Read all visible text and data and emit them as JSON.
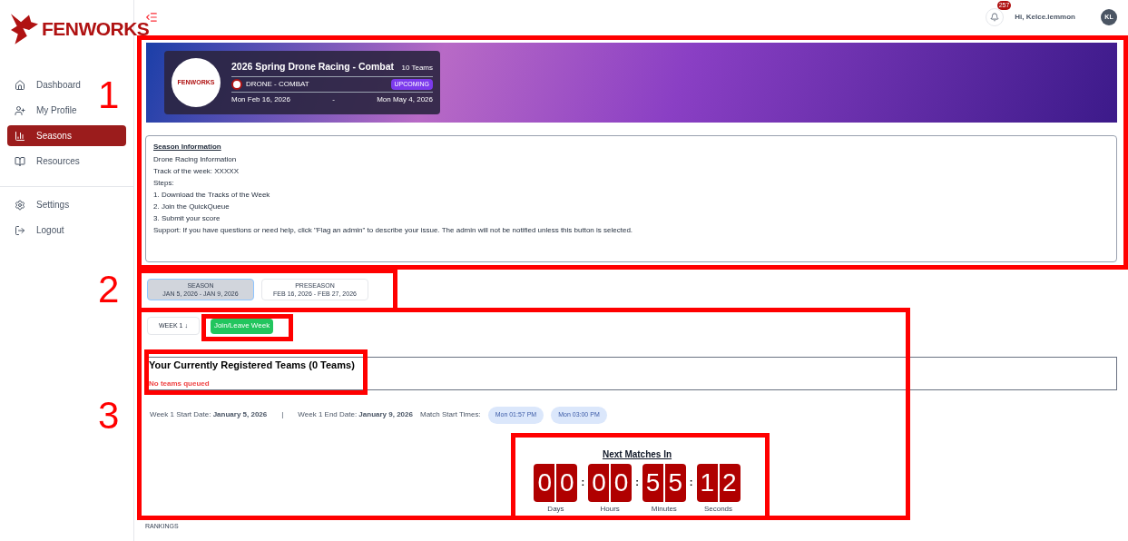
{
  "brand": {
    "name": "FENWORKS"
  },
  "sidebar": {
    "items": [
      {
        "label": "Dashboard",
        "selected": false
      },
      {
        "label": "My Profile",
        "selected": false
      },
      {
        "label": "Seasons",
        "selected": true
      },
      {
        "label": "Resources",
        "selected": false
      }
    ],
    "bottom_items": [
      {
        "label": "Settings"
      },
      {
        "label": "Logout"
      }
    ]
  },
  "header": {
    "notification_count": "257",
    "greeting": "Hi, Kelce.lemmon",
    "avatar": "KL"
  },
  "banner": {
    "logo_text": "FENWORKS",
    "title": "2026 Spring Drone Racing - Combat",
    "teams": "10 Teams",
    "game": "DRONE - COMBAT",
    "status": "UPCOMING",
    "start": "Mon Feb 16, 2026",
    "dash": "-",
    "end": "Mon May 4, 2026"
  },
  "info": {
    "title": "Season Information",
    "paragraphs": [
      [
        "Drone Racing Information",
        "Track of the week: XXXXX"
      ],
      [
        "Steps:",
        "1. Download the Tracks of the Week",
        "2. Join the QuickQueue",
        "3. Submit your score"
      ],
      [
        "Support: If you have questions or need help, click \"Flag an admin\" to describe your issue. The admin will not be notified unless this button is selected."
      ]
    ]
  },
  "season_tabs": [
    {
      "label": "SEASON",
      "dates": "JAN 5, 2026 - JAN 9, 2026",
      "selected": true
    },
    {
      "label": "PRESEASON",
      "dates": "FEB 16, 2026 - FEB 27, 2026",
      "selected": false
    }
  ],
  "week_select": "WEEK 1 ↓",
  "join_button": "Join/Leave Week",
  "registered": {
    "title": "Your Currently Registered Teams (0 Teams)",
    "empty": "No teams queued"
  },
  "dates": {
    "start": "Week 1 Start Date: **January 5, 2026**",
    "separator": "|",
    "end": "Week 1 End Date: **January 9, 2026**",
    "times_label": "Match Start Times:",
    "times": [
      "Mon 01:57 PM",
      "Mon 03:00 PM"
    ]
  },
  "countdown": {
    "title": "Next Matches In",
    "separator": ":",
    "units": [
      {
        "value": "00",
        "label": "Days"
      },
      {
        "value": "00",
        "label": "Hours"
      },
      {
        "value": "55",
        "label": "Minutes"
      },
      {
        "value": "12",
        "label": "Seconds"
      }
    ]
  },
  "rankings": "RANKINGS",
  "annotations": [
    "1",
    "2",
    "3"
  ]
}
